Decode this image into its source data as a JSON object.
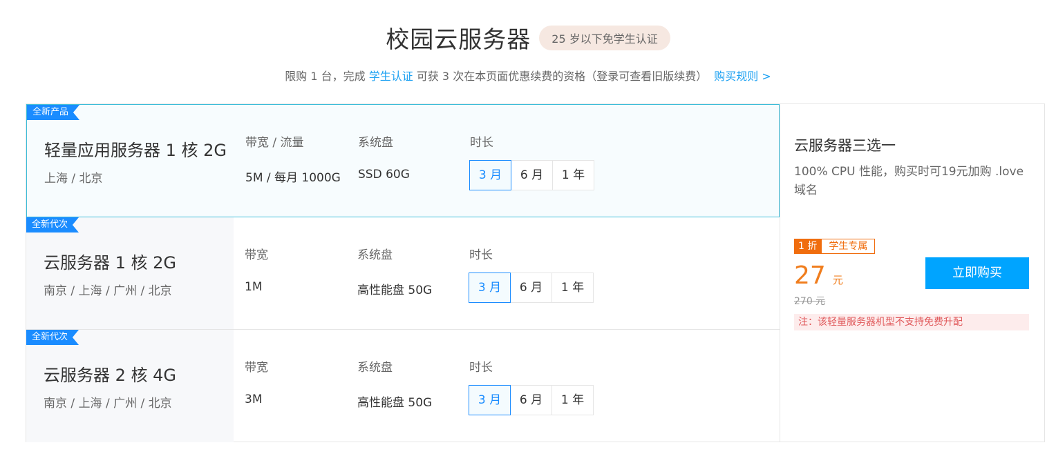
{
  "header": {
    "title": "校园云服务器",
    "badge": "25 岁以下免学生认证",
    "subtitle_pre": "限购 1 台，完成 ",
    "subtitle_link": "学生认证",
    "subtitle_post": " 可获 3 次在本页面优惠续费的资格（登录可查看旧版续费）",
    "rules_link": "购买规则 >"
  },
  "plans": [
    {
      "tag": "全新产品",
      "name": "轻量应用服务器 1 核 2G",
      "region": "上海 / 北京",
      "bandwidth_label": "带宽 / 流量",
      "bandwidth_value": "5M / 每月 1000G",
      "disk_label": "系统盘",
      "disk_value": "SSD 60G",
      "duration_label": "时长",
      "durations": [
        "3 月",
        "6 月",
        "1 年"
      ]
    },
    {
      "tag": "全新代次",
      "name": "云服务器 1 核 2G",
      "region": "南京 / 上海 / 广州 / 北京",
      "bandwidth_label": "带宽",
      "bandwidth_value": "1M",
      "disk_label": "系统盘",
      "disk_value": "高性能盘 50G",
      "duration_label": "时长",
      "durations": [
        "3 月",
        "6 月",
        "1 年"
      ]
    },
    {
      "tag": "全新代次",
      "name": "云服务器 2 核 4G",
      "region": "南京 / 上海 / 广州 / 北京",
      "bandwidth_label": "带宽",
      "bandwidth_value": "3M",
      "disk_label": "系统盘",
      "disk_value": "高性能盘 50G",
      "duration_label": "时长",
      "durations": [
        "3 月",
        "6 月",
        "1 年"
      ]
    }
  ],
  "side": {
    "title": "云服务器三选一",
    "desc": "100% CPU 性能，购买时可19元加购 .love 域名",
    "discount": "1 折",
    "student": "学生专属",
    "price": "27",
    "unit": "元",
    "old_price": "270 元",
    "buy_label": "立即购买",
    "note": "注：该轻量服务器机型不支持免费升配"
  },
  "colors": {
    "accent": "#1a8cff",
    "buy": "#00a4ff",
    "price": "#f07d1d",
    "note_bg": "#fdecec"
  }
}
